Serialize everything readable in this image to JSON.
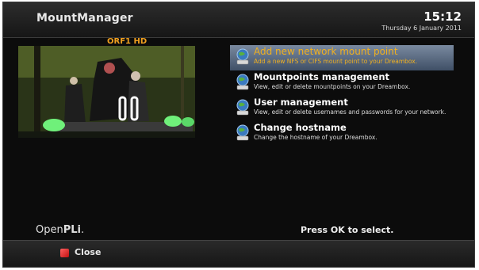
{
  "window": {
    "title": "MountManager",
    "time": "15:12",
    "date": "Thursday 6 January 2011"
  },
  "preview": {
    "channel": "ORF1 HD"
  },
  "menu": {
    "items": [
      {
        "label": "Add new network mount point",
        "description": "Add a new NFS or CIFS mount point to your Dreambox.",
        "icon": "network-globe-icon",
        "selected": true
      },
      {
        "label": "Mountpoints management",
        "description": "View, edit or delete mountpoints on your Dreambox.",
        "icon": "network-globe-icon",
        "selected": false
      },
      {
        "label": "User management",
        "description": "View, edit or delete usernames and passwords for your network.",
        "icon": "network-globe-icon",
        "selected": false
      },
      {
        "label": "Change hostname",
        "description": "Change the hostname of your Dreambox.",
        "icon": "network-globe-icon",
        "selected": false
      }
    ]
  },
  "footer": {
    "logo_open": "Open",
    "logo_pli": "PLi",
    "logo_dot": ".",
    "hint": "Press OK to select.",
    "close_label": "Close",
    "close_key_color": "#d01818"
  },
  "colors": {
    "selected_text": "#f0b020",
    "selection_bar": "#5a6a82",
    "channel_label": "#f0a020",
    "background": "#0c0c0c"
  }
}
